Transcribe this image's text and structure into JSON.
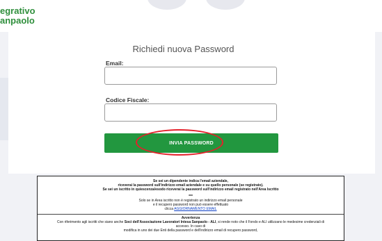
{
  "brand": {
    "line1": "egrativo",
    "line2": "anpaolo"
  },
  "form": {
    "title": "Richiedi nuova Password",
    "email_label": "Email:",
    "email_value": "",
    "cf_label": "Codice Fiscale:",
    "cf_value": "",
    "submit_label": "INVIA PASSWORD"
  },
  "notice": {
    "line1": "Se sei un dipendente indica l'email aziendale,",
    "line2": "riceverai la password sull'indirizzo email aziendale e su quello personale (se registrato).",
    "line3": "Se sei un iscritto in quiescenza/esodo riceverai la password sull'indirizzo email registrato nell'Area Iscritto",
    "separator": "***",
    "line4": "Solo se in Area iscritto non è registrato un indirizzo email personale",
    "line5": "e il recupero password non può essere effettuato",
    "line6_prefix": "clicca",
    "link_text": "AGGIORNAMENTO EMAIL",
    "warning_title": "Avvertenza",
    "warning_line1_a": "Con riferimento agli iscritti che siano anche",
    "warning_line1_b": "Soci dell'Associazione Lavoratori Intesa Sanpaolo - ALI",
    "warning_line1_c": ", si rende noto che il Fondo e ALI utilizzano le medesime credenziali di",
    "warning_line2": "accesso. In caso di",
    "warning_line3": "modifica in uno dei due Enti della password e dell'indirizzo email di recupero password,"
  },
  "colors": {
    "brand_green": "#2f8f3c",
    "button_green": "#22973f",
    "highlight_red": "#e4202a",
    "link_blue": "#0b3ec4"
  }
}
